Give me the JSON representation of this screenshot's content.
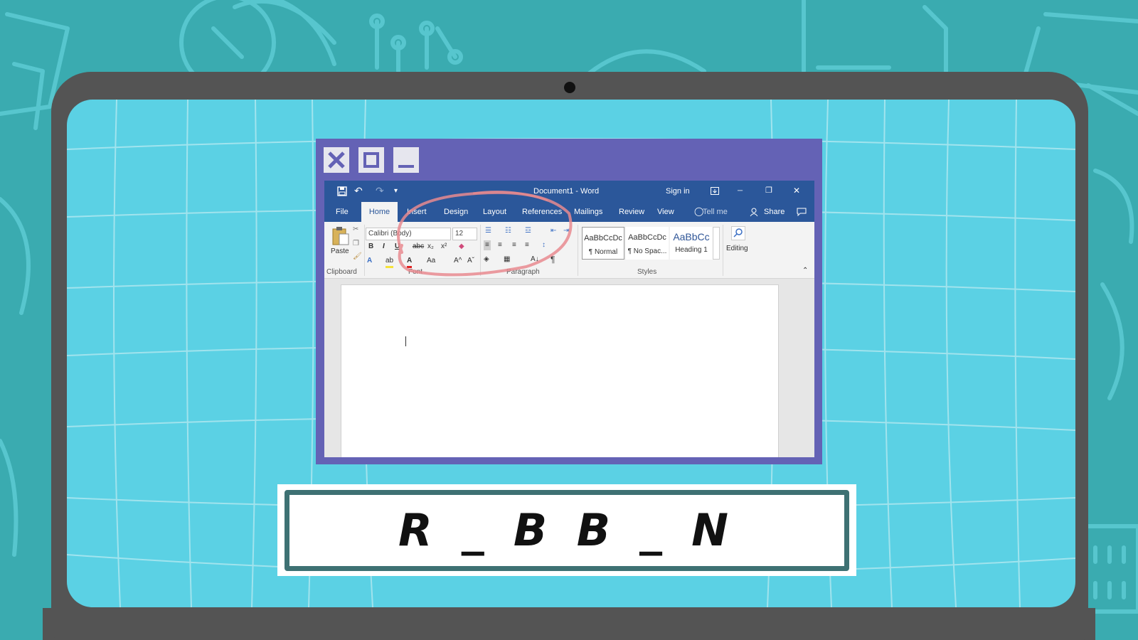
{
  "outer_window": {
    "close_glyph": "✕",
    "maximize_glyph": "◻",
    "minimize_glyph": "▁"
  },
  "word": {
    "title": "Document1  -  Word",
    "sign_in": "Sign in",
    "quick_access": {
      "undo": "↶",
      "redo": "↷",
      "customize": "▾"
    },
    "window_controls": {
      "minimize": "─",
      "restore": "❐",
      "close": "✕"
    },
    "tabs": [
      {
        "label": "File"
      },
      {
        "label": "Home"
      },
      {
        "label": "Insert"
      },
      {
        "label": "Design"
      },
      {
        "label": "Layout"
      },
      {
        "label": "References"
      },
      {
        "label": "Mailings"
      },
      {
        "label": "Review"
      },
      {
        "label": "View"
      }
    ],
    "tell_me": "Tell me",
    "share": "Share",
    "ribbon": {
      "clipboard": {
        "paste_label": "Paste",
        "group_label": "Clipboard"
      },
      "font": {
        "font_name": "Calibri (Body)",
        "font_size": "12",
        "bold": "B",
        "italic": "I",
        "underline": "U",
        "strikethrough": "abc",
        "subscript": "x₂",
        "superscript": "x²",
        "grow": "A^",
        "shrink": "Aˇ",
        "change_case": "Aa",
        "group_label": "Font"
      },
      "paragraph": {
        "group_label": "Paragraph",
        "pilcrow": "¶"
      },
      "styles": {
        "group_label": "Styles",
        "items": [
          {
            "preview": "AaBbCcDc",
            "name": "¶ Normal"
          },
          {
            "preview": "AaBbCcDc",
            "name": "¶ No Spac..."
          },
          {
            "preview": "AaBbCc",
            "name": "Heading 1"
          }
        ]
      },
      "editing": {
        "label": "Editing"
      }
    }
  },
  "banner": {
    "text": "R _ B B _ N"
  },
  "colors": {
    "word_blue": "#2b579a",
    "outer_purple": "#6462b5",
    "screen_cyan": "#5bd1e4",
    "laptop_gray": "#545454",
    "circle_red": "#e88a8f",
    "banner_border": "#3e7173"
  }
}
